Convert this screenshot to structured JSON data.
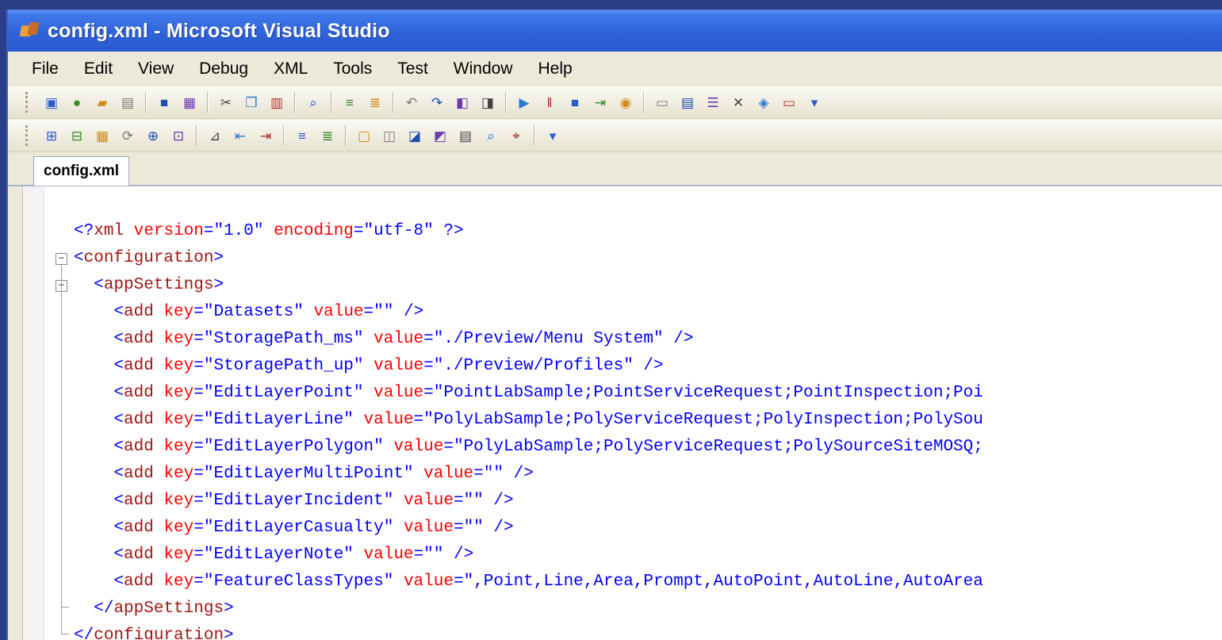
{
  "window": {
    "title": "config.xml - Microsoft Visual Studio"
  },
  "menu": [
    "File",
    "Edit",
    "View",
    "Debug",
    "XML",
    "Tools",
    "Test",
    "Window",
    "Help"
  ],
  "toolbars": {
    "standard": [
      "new-project-icon",
      "globe-icon",
      "open-folder-icon",
      "add-item-icon",
      "save-icon",
      "save-all-icon",
      "cut-icon",
      "copy-icon",
      "paste-icon",
      "find-icon",
      "comment-icon",
      "uncomment-icon",
      "undo-icon",
      "redo-icon",
      "navigate-back-icon",
      "navigate-forward-icon",
      "start-icon",
      "pause-icon",
      "stop-icon",
      "step-icon",
      "breakpoint-icon",
      "window-icon",
      "solution-explorer-icon",
      "properties-icon",
      "toolbox-icon",
      "object-browser-icon",
      "error-list-icon",
      "more-icon"
    ],
    "xml": [
      "schema-icon",
      "xsl-icon",
      "grid-icon",
      "refresh-icon",
      "attach-icon",
      "dataset-icon",
      "format-icon",
      "indent-icon",
      "outdent-icon",
      "align-center-icon",
      "align-justify-icon",
      "bookmark-icon",
      "prev-bookmark-icon",
      "next-bookmark-icon",
      "clear-bookmark-icon",
      "outline-icon",
      "find-icon",
      "xpath-icon",
      "more-icon"
    ]
  },
  "tab": {
    "label": "config.xml"
  },
  "code_lines": [
    {
      "indent": 0,
      "pre": "<?",
      "tag": "xml",
      "parts": [
        {
          "attr": "version",
          "val": "\"1.0\""
        },
        {
          "attr": "encoding",
          "val": "\"utf-8\""
        }
      ],
      "post": " ?>"
    },
    {
      "indent": 0,
      "pre": "<",
      "tag": "configuration",
      "parts": [],
      "post": ">"
    },
    {
      "indent": 1,
      "pre": "<",
      "tag": "appSettings",
      "parts": [],
      "post": ">"
    },
    {
      "indent": 2,
      "pre": "<",
      "tag": "add",
      "parts": [
        {
          "attr": "key",
          "val": "\"Datasets\""
        },
        {
          "attr": "value",
          "val": "\"\""
        }
      ],
      "post": " />"
    },
    {
      "indent": 2,
      "pre": "<",
      "tag": "add",
      "parts": [
        {
          "attr": "key",
          "val": "\"StoragePath_ms\""
        },
        {
          "attr": "value",
          "val": "\"./Preview/Menu System\""
        }
      ],
      "post": " />"
    },
    {
      "indent": 2,
      "pre": "<",
      "tag": "add",
      "parts": [
        {
          "attr": "key",
          "val": "\"StoragePath_up\""
        },
        {
          "attr": "value",
          "val": "\"./Preview/Profiles\""
        }
      ],
      "post": " />"
    },
    {
      "indent": 2,
      "pre": "<",
      "tag": "add",
      "parts": [
        {
          "attr": "key",
          "val": "\"EditLayerPoint\""
        },
        {
          "attr": "value",
          "val": "\"PointLabSample;PointServiceRequest;PointInspection;Poi"
        }
      ],
      "post": ""
    },
    {
      "indent": 2,
      "pre": "<",
      "tag": "add",
      "parts": [
        {
          "attr": "key",
          "val": "\"EditLayerLine\""
        },
        {
          "attr": "value",
          "val": "\"PolyLabSample;PolyServiceRequest;PolyInspection;PolySou"
        }
      ],
      "post": ""
    },
    {
      "indent": 2,
      "pre": "<",
      "tag": "add",
      "parts": [
        {
          "attr": "key",
          "val": "\"EditLayerPolygon\""
        },
        {
          "attr": "value",
          "val": "\"PolyLabSample;PolyServiceRequest;PolySourceSiteMOSQ;"
        }
      ],
      "post": ""
    },
    {
      "indent": 2,
      "pre": "<",
      "tag": "add",
      "parts": [
        {
          "attr": "key",
          "val": "\"EditLayerMultiPoint\""
        },
        {
          "attr": "value",
          "val": "\"\""
        }
      ],
      "post": " />"
    },
    {
      "indent": 2,
      "pre": "<",
      "tag": "add",
      "parts": [
        {
          "attr": "key",
          "val": "\"EditLayerIncident\""
        },
        {
          "attr": "value",
          "val": "\"\""
        }
      ],
      "post": " />"
    },
    {
      "indent": 2,
      "pre": "<",
      "tag": "add",
      "parts": [
        {
          "attr": "key",
          "val": "\"EditLayerCasualty\""
        },
        {
          "attr": "value",
          "val": "\"\""
        }
      ],
      "post": " />"
    },
    {
      "indent": 2,
      "pre": "<",
      "tag": "add",
      "parts": [
        {
          "attr": "key",
          "val": "\"EditLayerNote\""
        },
        {
          "attr": "value",
          "val": "\"\""
        }
      ],
      "post": " />"
    },
    {
      "indent": 2,
      "pre": "<",
      "tag": "add",
      "parts": [
        {
          "attr": "key",
          "val": "\"FeatureClassTypes\""
        },
        {
          "attr": "value",
          "val": "\",Point,Line,Area,Prompt,AutoPoint,AutoLine,AutoArea"
        }
      ],
      "post": ""
    },
    {
      "indent": 1,
      "pre": "</",
      "tag": "appSettings",
      "parts": [],
      "post": ">"
    },
    {
      "indent": 0,
      "pre": "</",
      "tag": "configuration",
      "parts": [],
      "post": ">"
    }
  ],
  "colors": {
    "title_bar": "#2f63d8",
    "xml_tag": "#a31515",
    "xml_bracket": "#0000ff",
    "xml_attr": "#ff0000",
    "xml_value": "#0000ff"
  }
}
